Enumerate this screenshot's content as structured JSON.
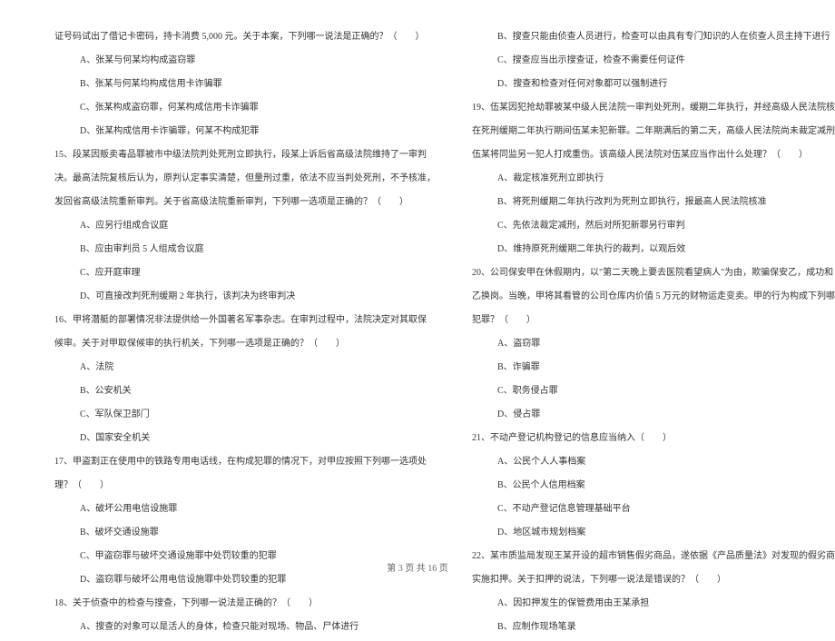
{
  "left": {
    "l0": "证号码试出了借记卡密码，持卡消费 5,000 元。关于本案，下列哪一说法是正确的？（　　）",
    "l0a": "A、张某与何某均构成盗窃罪",
    "l0b": "B、张某与何某均构成信用卡诈骗罪",
    "l0c": "C、张某构成盗窃罪，何某构成信用卡诈骗罪",
    "l0d": "D、张某构成信用卡诈骗罪，何某不构成犯罪",
    "l15": "15、段某因贩卖毒品罪被市中级法院判处死刑立即执行，段某上诉后省高级法院维持了一审判",
    "l15_2": "决。最高法院复核后认为，原判认定事实清楚，但量刑过重，依法不应当判处死刑，不予核准，",
    "l15_3": "发回省高级法院重新审判。关于省高级法院重新审判，下列哪一选项是正确的？（　　）",
    "l15a": "A、应另行组成合议庭",
    "l15b": "B、应由审判员 5 人组成合议庭",
    "l15c": "C、应开庭审理",
    "l15d": "D、可直接改判死刑缓期 2 年执行，该判决为终审判决",
    "l16": "16、甲将潜艇的部署情况非法提供给一外国著名军事杂志。在审判过程中，法院决定对其取保",
    "l16_2": "候审。关于对甲取保候审的执行机关，下列哪一选项是正确的？（　　）",
    "l16a": "A、法院",
    "l16b": "B、公安机关",
    "l16c": "C、军队保卫部门",
    "l16d": "D、国家安全机关",
    "l17": "17、甲盗割正在使用中的铁路专用电话线，在构成犯罪的情况下，对甲应按照下列哪一选项处",
    "l17_2": "理？（　　）",
    "l17a": "A、破坏公用电信设施罪",
    "l17b": "B、破坏交通设施罪",
    "l17c": "C、甲盗窃罪与破坏交通设施罪中处罚较重的犯罪",
    "l17d": "D、盗窃罪与破坏公用电信设施罪中处罚较重的犯罪",
    "l18": "18、关于侦查中的检查与搜查，下列哪一说法是正确的？（　　）",
    "l18a": "A、搜查的对象可以是活人的身体，检查只能对现场、物品、尸体进行"
  },
  "right": {
    "r18b": "B、搜查只能由侦查人员进行，检查可以由具有专门知识的人在侦查人员主持下进行",
    "r18c": "C、搜查应当出示搜查证，检查不需要任何证件",
    "r18d": "D、搜查和检查对任何对象都可以强制进行",
    "r19": "19、伍某因犯抢劫罪被某中级人民法院一审判处死刑，缓期二年执行，并经高级人民法院核准。",
    "r19_2": "在死刑缓期二年执行期间伍某未犯新罪。二年期满后的第二天，高级人民法院尚未裁定减刑，",
    "r19_3": "伍某将同监另一犯人打成重伤。该高级人民法院对伍某应当作出什么处理？（　　）",
    "r19a": "A、裁定核准死刑立即执行",
    "r19b": "B、将死刑缓期二年执行改判为死刑立即执行，报最高人民法院核准",
    "r19c": "C、先依法裁定减刑，然后对所犯新罪另行审判",
    "r19d": "D、维持原死刑缓期二年执行的裁判，以观后效",
    "r20": "20、公司保安甲在休假期内，以\"第二天晚上要去医院看望病人\"为由，欺骗保安乙，成功和",
    "r20_2": "乙换岗。当晚，甲将其看管的公司仓库内价值 5 万元的财物运走变卖。甲的行为构成下列哪一",
    "r20_3": "犯罪？（　　）",
    "r20a": "A、盗窃罪",
    "r20b": "B、诈骗罪",
    "r20c": "C、职务侵占罪",
    "r20d": "D、侵占罪",
    "r21": "21、不动产登记机构登记的信息应当纳入（　　）",
    "r21a": "A、公民个人人事档案",
    "r21b": "B、公民个人信用档案",
    "r21c": "C、不动产登记信息管理基础平台",
    "r21d": "D、地区城市规划档案",
    "r22": "22、某市质监局发现王某开设的超市销售假劣商品，遂依据《产品质量法》对发现的假劣商品",
    "r22_2": "实施扣押。关于扣押的说法，下列哪一说法是错误的？（　　）",
    "r22a": "A、因扣押发生的保管费用由王某承担",
    "r22b": "B、应制作现场笔录"
  },
  "footer": "第 3 页 共 16 页"
}
